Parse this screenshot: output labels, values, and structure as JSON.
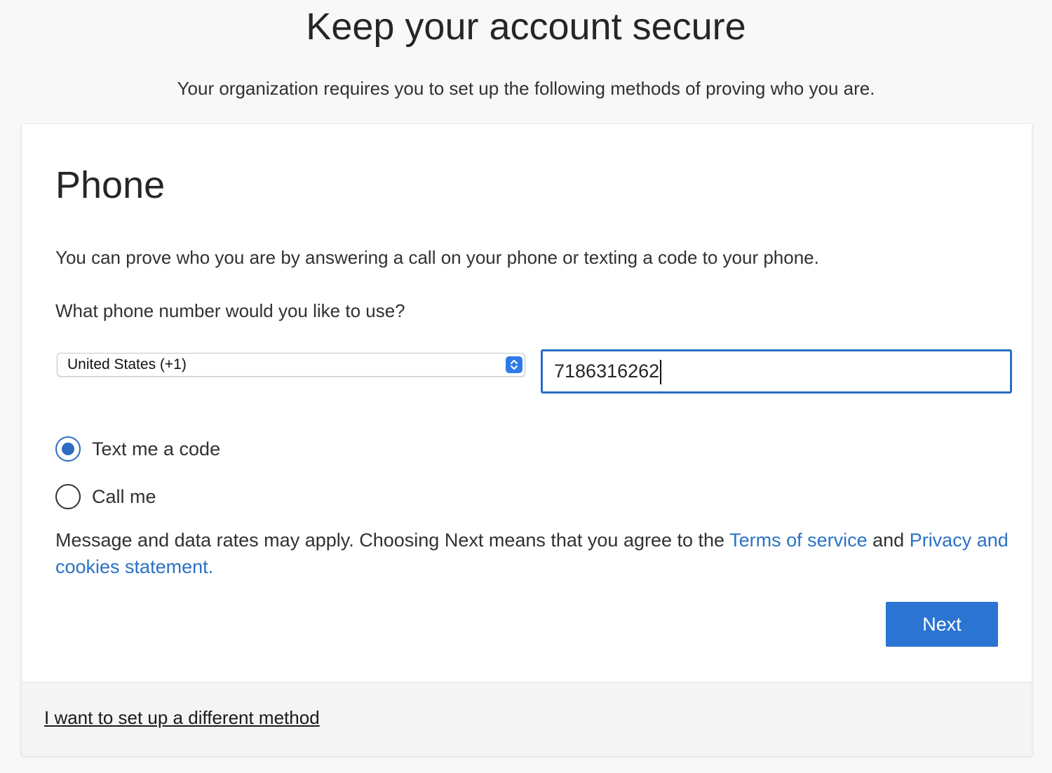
{
  "header": {
    "title": "Keep your account secure",
    "subtitle": "Your organization requires you to set up the following methods of proving who you are."
  },
  "card": {
    "section_title": "Phone",
    "description": "You can prove who you are by answering a call on your phone or texting a code to your phone.",
    "question": "What phone number would you like to use?",
    "country_select": {
      "selected": "United States (+1)"
    },
    "phone_input": {
      "value": "7186316262"
    },
    "options": [
      {
        "label": "Text me a code",
        "selected": true
      },
      {
        "label": "Call me",
        "selected": false
      }
    ],
    "legal": {
      "text_before": "Message and data rates may apply. Choosing Next means that you agree to the ",
      "terms_link": "Terms of service",
      "text_middle": " and ",
      "privacy_link": "Privacy and cookies statement."
    },
    "next_label": "Next"
  },
  "footer": {
    "alt_method_link": "I want to set up a different method"
  },
  "colors": {
    "accent": "#2b74d1",
    "link": "#2b72c6",
    "page_background": "#f8f8f8",
    "footer_background": "#f4f4f4"
  },
  "icons": {
    "select_arrows": "chevron-up-down-icon",
    "radio_selected": "radio-selected-icon",
    "radio_unselected": "radio-unselected-icon"
  }
}
